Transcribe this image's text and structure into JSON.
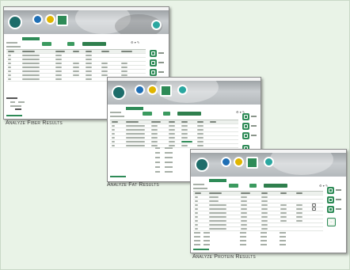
{
  "captions": {
    "fiber": "Analyze Fiber Results",
    "fat": "Analyze Fat Results",
    "protein": "Analyze Protein Results"
  },
  "colors": {
    "background": "#e9f3e7",
    "accent_green": "#2e8b57",
    "fiber_icon": "#1f6fb5",
    "fat_icon": "#e0b500",
    "protein_icon": "#2aa7a0"
  },
  "icons": {
    "nav": [
      "home-icon",
      "fiber-icon",
      "fat-icon",
      "protein-icon",
      "settings-icon"
    ],
    "side": [
      "export-icon",
      "print-icon",
      "report-icon"
    ]
  }
}
